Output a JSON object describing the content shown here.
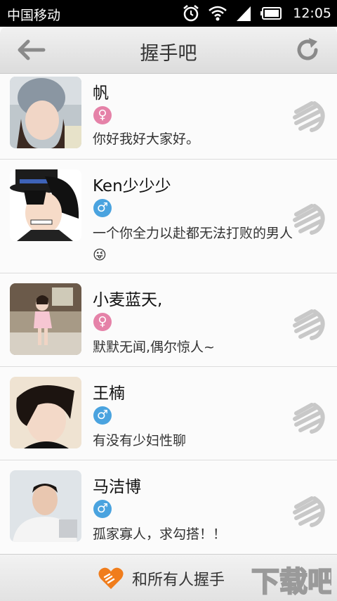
{
  "status_bar": {
    "carrier": "中国移动",
    "time": "12:05"
  },
  "header": {
    "title": "握手吧"
  },
  "users": [
    {
      "name": "帆",
      "gender": "female",
      "gender_symbol": "♀",
      "signature": "你好我好大家好。"
    },
    {
      "name": "Ken少少少",
      "gender": "male",
      "gender_symbol": "♂",
      "signature": "一个你全力以赴都无法打败的男人😜"
    },
    {
      "name": "小麦蓝天,",
      "gender": "female",
      "gender_symbol": "♀",
      "signature": "默默无闻,偶尔惊人~"
    },
    {
      "name": "王楠",
      "gender": "male",
      "gender_symbol": "♂",
      "signature": "有没有少妇性聊"
    },
    {
      "name": "马洁博",
      "gender": "male",
      "gender_symbol": "♂",
      "signature": "孤家寡人，求勾搭！！"
    }
  ],
  "footer": {
    "shake_all_label": "和所有人握手",
    "watermark": "下载吧"
  },
  "colors": {
    "female": "#e582a8",
    "male": "#4aa3df",
    "accent": "#f07d1c"
  }
}
